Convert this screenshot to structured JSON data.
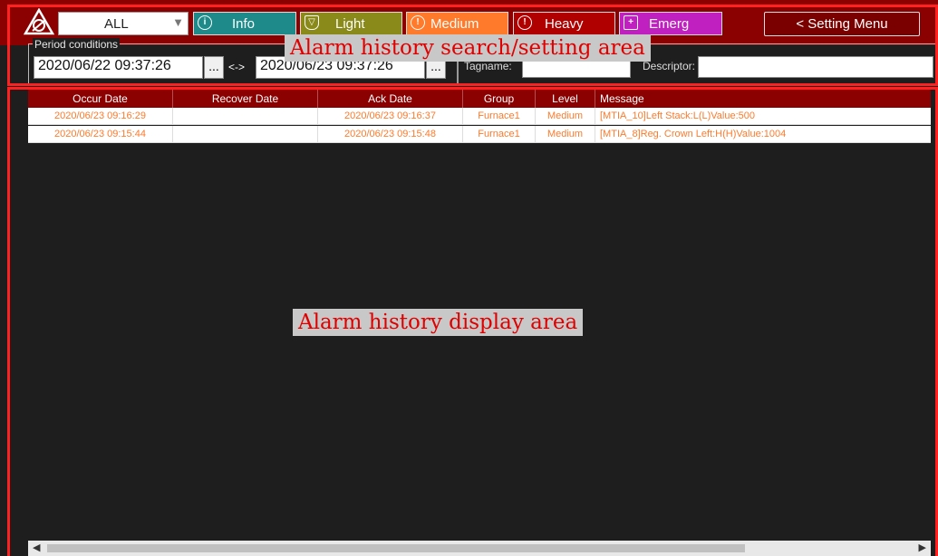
{
  "toolbar": {
    "filter_value": "ALL",
    "levels": [
      {
        "label": "Info",
        "icon": "info-icon",
        "color": "#1f8a8a"
      },
      {
        "label": "Light",
        "icon": "light-shield-icon",
        "color": "#8a8a1a"
      },
      {
        "label": "Medium",
        "icon": "medium-warning-icon",
        "color": "#ff7a2a"
      },
      {
        "label": "Heavy",
        "icon": "heavy-alert-icon",
        "color": "#b00000"
      },
      {
        "label": "Emerg",
        "icon": "emergency-icon",
        "color": "#c020c0"
      }
    ],
    "setting_menu": "< Setting Menu"
  },
  "period": {
    "legend": "Period conditions",
    "start": "2020/06/22 09:37:26",
    "end": "2020/06/23 09:37:26",
    "dots": "...",
    "separator": "<->",
    "tagname_label": "Tagname:",
    "descriptor_label": "Descriptor:"
  },
  "annotations": {
    "search_area": "Alarm history search/setting area",
    "display_area": "Alarm history display area"
  },
  "table": {
    "columns": [
      "Occur Date",
      "Recover Date",
      "Ack Date",
      "Group",
      "Level",
      "Message"
    ],
    "rows": [
      {
        "occur": "2020/06/23 09:16:29",
        "recover": "",
        "ack": "2020/06/23 09:16:37",
        "group": "Furnace1",
        "level": "Medium",
        "message": "[MTIA_10]Left Stack:L(L)Value:500"
      },
      {
        "occur": "2020/06/23 09:15:44",
        "recover": "",
        "ack": "2020/06/23 09:15:48",
        "group": "Furnace1",
        "level": "Medium",
        "message": "[MTIA_8]Reg. Crown Left:H(H)Value:1004"
      }
    ]
  },
  "colors": {
    "header_bg": "#8b0000",
    "row_text": "#ff7a2a",
    "annotation_red": "#ff2020"
  }
}
